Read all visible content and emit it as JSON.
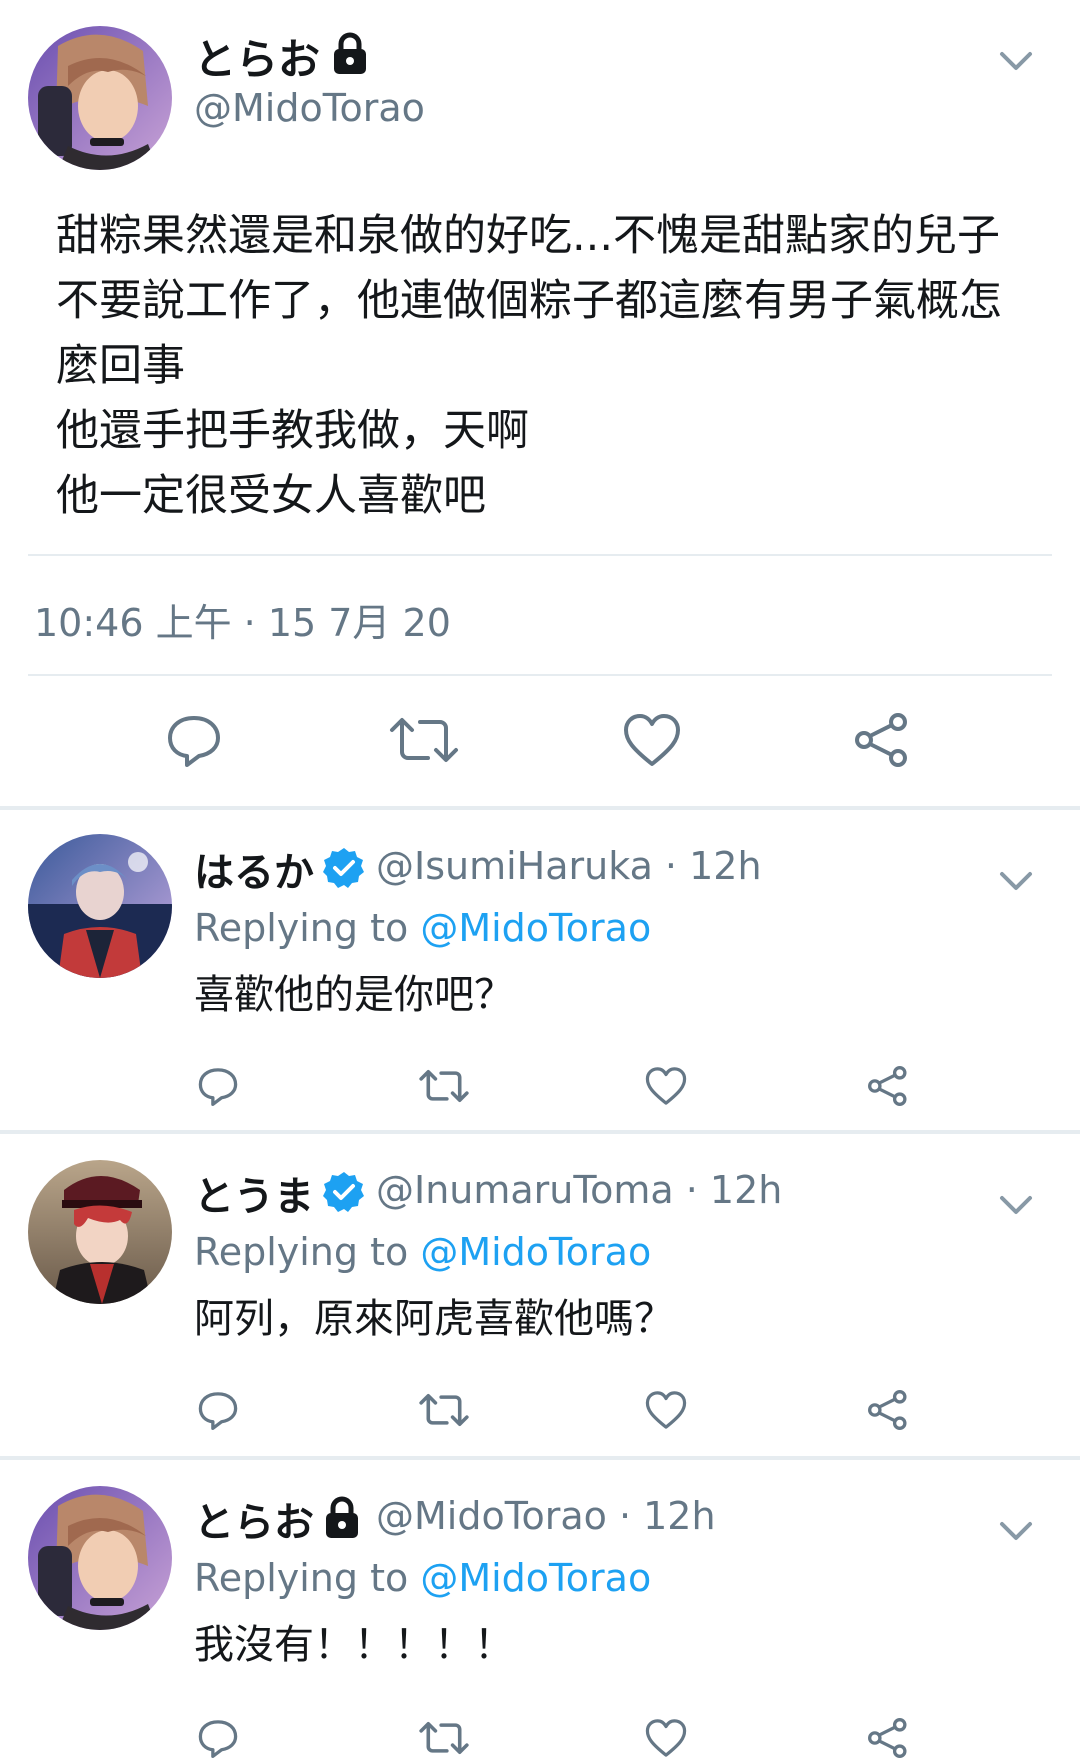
{
  "main_tweet": {
    "display_name": "とらお",
    "handle": "@MidoTorao",
    "text_lines": [
      "甜粽果然還是和泉做的好吃...不愧是甜點家的兒子",
      "不要說工作了，他連做個粽子都這麼有男子氣概怎",
      "麼回事",
      "他還手把手教我做，天啊",
      "他一定很受女人喜歡吧"
    ],
    "timestamp": "10:46 上午 · 15 7月 20"
  },
  "replies": [
    {
      "display_name": "はるか",
      "handle_time": "@IsumiHaruka · 12h",
      "replying_prefix": "Replying to ",
      "replying_to": "@MidoTorao",
      "text": "喜歡他的是你吧？"
    },
    {
      "display_name": "とうま",
      "handle_time": "@InumaruToma · 12h",
      "replying_prefix": "Replying to ",
      "replying_to": "@MidoTorao",
      "text": "阿列，原來阿虎喜歡他嗎？"
    },
    {
      "display_name": "とらお",
      "handle_time": "@MidoTorao · 12h",
      "replying_prefix": "Replying to ",
      "replying_to": "@MidoTorao",
      "text": "我沒有！！！！！"
    }
  ],
  "icons": {
    "reply": "reply-icon",
    "retweet": "retweet-icon",
    "like": "heart-icon",
    "share": "share-icon",
    "more": "chevron-down-icon",
    "verified": "verified-badge-icon",
    "protected": "lock-icon"
  },
  "colors": {
    "accent": "#1da1f2",
    "secondary_text": "#657786",
    "divider": "#e6ecf0"
  }
}
